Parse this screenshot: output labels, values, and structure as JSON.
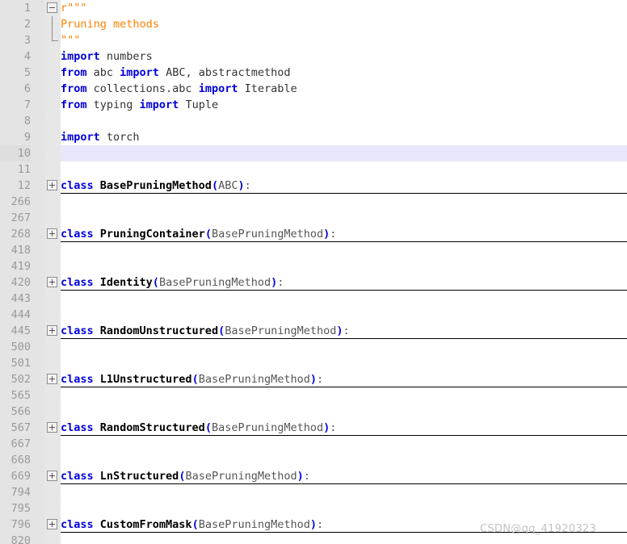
{
  "editor": {
    "watermark": "CSDN@qq_41920323",
    "current_line": 10,
    "colors": {
      "gutter_bg": "#e4e4e4",
      "line_number": "#9a9a9a",
      "keyword": "#0000dd",
      "classname": "#000000",
      "docstring": "#ff8000",
      "base_class": "#555555",
      "current_line_highlight": "#e8e8fa",
      "fold_underline": "#000000",
      "background": "#ffffff"
    },
    "fold_icons": {
      "expanded": "minus-box-icon",
      "collapsed": "plus-box-icon"
    }
  },
  "lines": [
    {
      "num": "1",
      "fold": "expanded-start",
      "folded": false,
      "tokens": [
        {
          "t": "docstr",
          "v": "r\"\"\""
        }
      ]
    },
    {
      "num": "2",
      "fold": "line",
      "folded": false,
      "tokens": [
        {
          "t": "docstr",
          "v": "Pruning methods"
        }
      ]
    },
    {
      "num": "3",
      "fold": "line-end",
      "folded": false,
      "tokens": [
        {
          "t": "docstr",
          "v": "\"\"\""
        }
      ]
    },
    {
      "num": "4",
      "fold": "none",
      "folded": false,
      "tokens": [
        {
          "t": "kw",
          "v": "import"
        },
        {
          "t": "ident",
          "v": " numbers"
        }
      ]
    },
    {
      "num": "5",
      "fold": "none",
      "folded": false,
      "tokens": [
        {
          "t": "kw",
          "v": "from"
        },
        {
          "t": "ident",
          "v": " abc "
        },
        {
          "t": "kw",
          "v": "import"
        },
        {
          "t": "ident",
          "v": " ABC, abstractmethod"
        }
      ]
    },
    {
      "num": "6",
      "fold": "none",
      "folded": false,
      "tokens": [
        {
          "t": "kw",
          "v": "from"
        },
        {
          "t": "ident",
          "v": " collections.abc "
        },
        {
          "t": "kw",
          "v": "import"
        },
        {
          "t": "ident",
          "v": " Iterable"
        }
      ]
    },
    {
      "num": "7",
      "fold": "none",
      "folded": false,
      "tokens": [
        {
          "t": "kw",
          "v": "from"
        },
        {
          "t": "ident",
          "v": " typing "
        },
        {
          "t": "kw",
          "v": "import"
        },
        {
          "t": "ident",
          "v": " Tuple"
        }
      ]
    },
    {
      "num": "8",
      "fold": "none",
      "folded": false,
      "tokens": []
    },
    {
      "num": "9",
      "fold": "none",
      "folded": false,
      "tokens": [
        {
          "t": "kw",
          "v": "import"
        },
        {
          "t": "ident",
          "v": " torch"
        }
      ]
    },
    {
      "num": "10",
      "fold": "none",
      "folded": false,
      "current": true,
      "tokens": []
    },
    {
      "num": "11",
      "fold": "none",
      "folded": false,
      "tokens": []
    },
    {
      "num": "12",
      "fold": "collapsed",
      "folded": true,
      "tokens": [
        {
          "t": "kw",
          "v": "class"
        },
        {
          "t": "cname",
          "v": " BasePruningMethod"
        },
        {
          "t": "punc",
          "v": "("
        },
        {
          "t": "base",
          "v": "ABC"
        },
        {
          "t": "punc",
          "v": ")"
        },
        {
          "t": "base",
          "v": ":"
        }
      ]
    },
    {
      "num": "266",
      "fold": "none",
      "folded": false,
      "tokens": []
    },
    {
      "num": "267",
      "fold": "none",
      "folded": false,
      "tokens": []
    },
    {
      "num": "268",
      "fold": "collapsed",
      "folded": true,
      "tokens": [
        {
          "t": "kw",
          "v": "class"
        },
        {
          "t": "cname",
          "v": " PruningContainer"
        },
        {
          "t": "punc",
          "v": "("
        },
        {
          "t": "base",
          "v": "BasePruningMethod"
        },
        {
          "t": "punc",
          "v": ")"
        },
        {
          "t": "base",
          "v": ":"
        }
      ]
    },
    {
      "num": "418",
      "fold": "none",
      "folded": false,
      "tokens": []
    },
    {
      "num": "419",
      "fold": "none",
      "folded": false,
      "tokens": []
    },
    {
      "num": "420",
      "fold": "collapsed",
      "folded": true,
      "tokens": [
        {
          "t": "kw",
          "v": "class"
        },
        {
          "t": "cname",
          "v": " Identity"
        },
        {
          "t": "punc",
          "v": "("
        },
        {
          "t": "base",
          "v": "BasePruningMethod"
        },
        {
          "t": "punc",
          "v": ")"
        },
        {
          "t": "base",
          "v": ":"
        }
      ]
    },
    {
      "num": "443",
      "fold": "none",
      "folded": false,
      "tokens": []
    },
    {
      "num": "444",
      "fold": "none",
      "folded": false,
      "tokens": []
    },
    {
      "num": "445",
      "fold": "collapsed",
      "folded": true,
      "tokens": [
        {
          "t": "kw",
          "v": "class"
        },
        {
          "t": "cname",
          "v": " RandomUnstructured"
        },
        {
          "t": "punc",
          "v": "("
        },
        {
          "t": "base",
          "v": "BasePruningMethod"
        },
        {
          "t": "punc",
          "v": ")"
        },
        {
          "t": "base",
          "v": ":"
        }
      ]
    },
    {
      "num": "500",
      "fold": "none",
      "folded": false,
      "tokens": []
    },
    {
      "num": "501",
      "fold": "none",
      "folded": false,
      "tokens": []
    },
    {
      "num": "502",
      "fold": "collapsed",
      "folded": true,
      "tokens": [
        {
          "t": "kw",
          "v": "class"
        },
        {
          "t": "cname",
          "v": " L1Unstructured"
        },
        {
          "t": "punc",
          "v": "("
        },
        {
          "t": "base",
          "v": "BasePruningMethod"
        },
        {
          "t": "punc",
          "v": ")"
        },
        {
          "t": "base",
          "v": ":"
        }
      ]
    },
    {
      "num": "565",
      "fold": "none",
      "folded": false,
      "tokens": []
    },
    {
      "num": "566",
      "fold": "none",
      "folded": false,
      "tokens": []
    },
    {
      "num": "567",
      "fold": "collapsed",
      "folded": true,
      "tokens": [
        {
          "t": "kw",
          "v": "class"
        },
        {
          "t": "cname",
          "v": " RandomStructured"
        },
        {
          "t": "punc",
          "v": "("
        },
        {
          "t": "base",
          "v": "BasePruningMethod"
        },
        {
          "t": "punc",
          "v": ")"
        },
        {
          "t": "base",
          "v": ":"
        }
      ]
    },
    {
      "num": "667",
      "fold": "none",
      "folded": false,
      "tokens": []
    },
    {
      "num": "668",
      "fold": "none",
      "folded": false,
      "tokens": []
    },
    {
      "num": "669",
      "fold": "collapsed",
      "folded": true,
      "tokens": [
        {
          "t": "kw",
          "v": "class"
        },
        {
          "t": "cname",
          "v": " LnStructured"
        },
        {
          "t": "punc",
          "v": "("
        },
        {
          "t": "base",
          "v": "BasePruningMethod"
        },
        {
          "t": "punc",
          "v": ")"
        },
        {
          "t": "base",
          "v": ":"
        }
      ]
    },
    {
      "num": "794",
      "fold": "none",
      "folded": false,
      "tokens": []
    },
    {
      "num": "795",
      "fold": "none",
      "folded": false,
      "tokens": []
    },
    {
      "num": "796",
      "fold": "collapsed",
      "folded": true,
      "tokens": [
        {
          "t": "kw",
          "v": "class"
        },
        {
          "t": "cname",
          "v": " CustomFromMask"
        },
        {
          "t": "punc",
          "v": "("
        },
        {
          "t": "base",
          "v": "BasePruningMethod"
        },
        {
          "t": "punc",
          "v": ")"
        },
        {
          "t": "base",
          "v": ":"
        }
      ]
    },
    {
      "num": "820",
      "fold": "none",
      "folded": false,
      "tokens": []
    }
  ]
}
